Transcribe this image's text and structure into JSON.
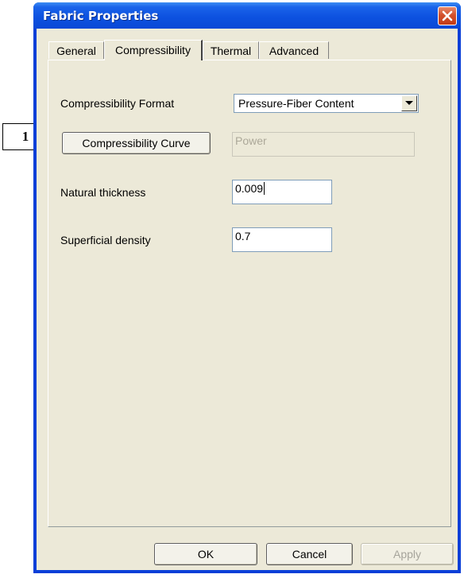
{
  "window": {
    "title": "Fabric Properties"
  },
  "tabs": [
    {
      "label": "General",
      "active": false
    },
    {
      "label": "Compressibility",
      "active": true
    },
    {
      "label": "Thermal",
      "active": false
    },
    {
      "label": "Advanced",
      "active": false
    }
  ],
  "form": {
    "format_label": "Compressibility Format",
    "format_value": "Pressure-Fiber Content",
    "curve_button": "Compressibility Curve",
    "curve_value": "Power",
    "thickness_label": "Natural thickness",
    "thickness_value": "0.009",
    "density_label": "Superficial density",
    "density_value": "0.7"
  },
  "footer": {
    "ok": "OK",
    "cancel": "Cancel",
    "apply": "Apply"
  },
  "annotation": {
    "callout_number": "1"
  },
  "colors": {
    "titlebar": "#0a48d6",
    "close": "#c43b16",
    "dialog_bg": "#ece9d8"
  }
}
